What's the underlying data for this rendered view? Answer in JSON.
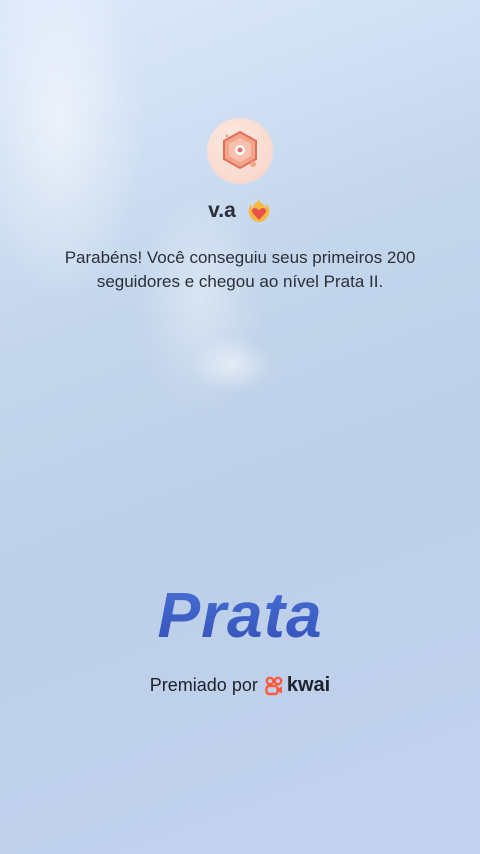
{
  "profile": {
    "username": "v.a",
    "avatar_icon": "badge-icon",
    "badge_icon": "heart-fire-icon"
  },
  "message": "Parabéns! Você conseguiu seus primeiros 200 seguidores e chegou ao nível Prata II.",
  "level_title": "Prata",
  "footer": {
    "awarded_label": "Premiado por",
    "brand_name": "kwai",
    "brand_icon": "kwai-logo-icon"
  },
  "colors": {
    "level": "#3f5fc7",
    "brand": "#ff5a3c",
    "text": "#2b2f38"
  }
}
